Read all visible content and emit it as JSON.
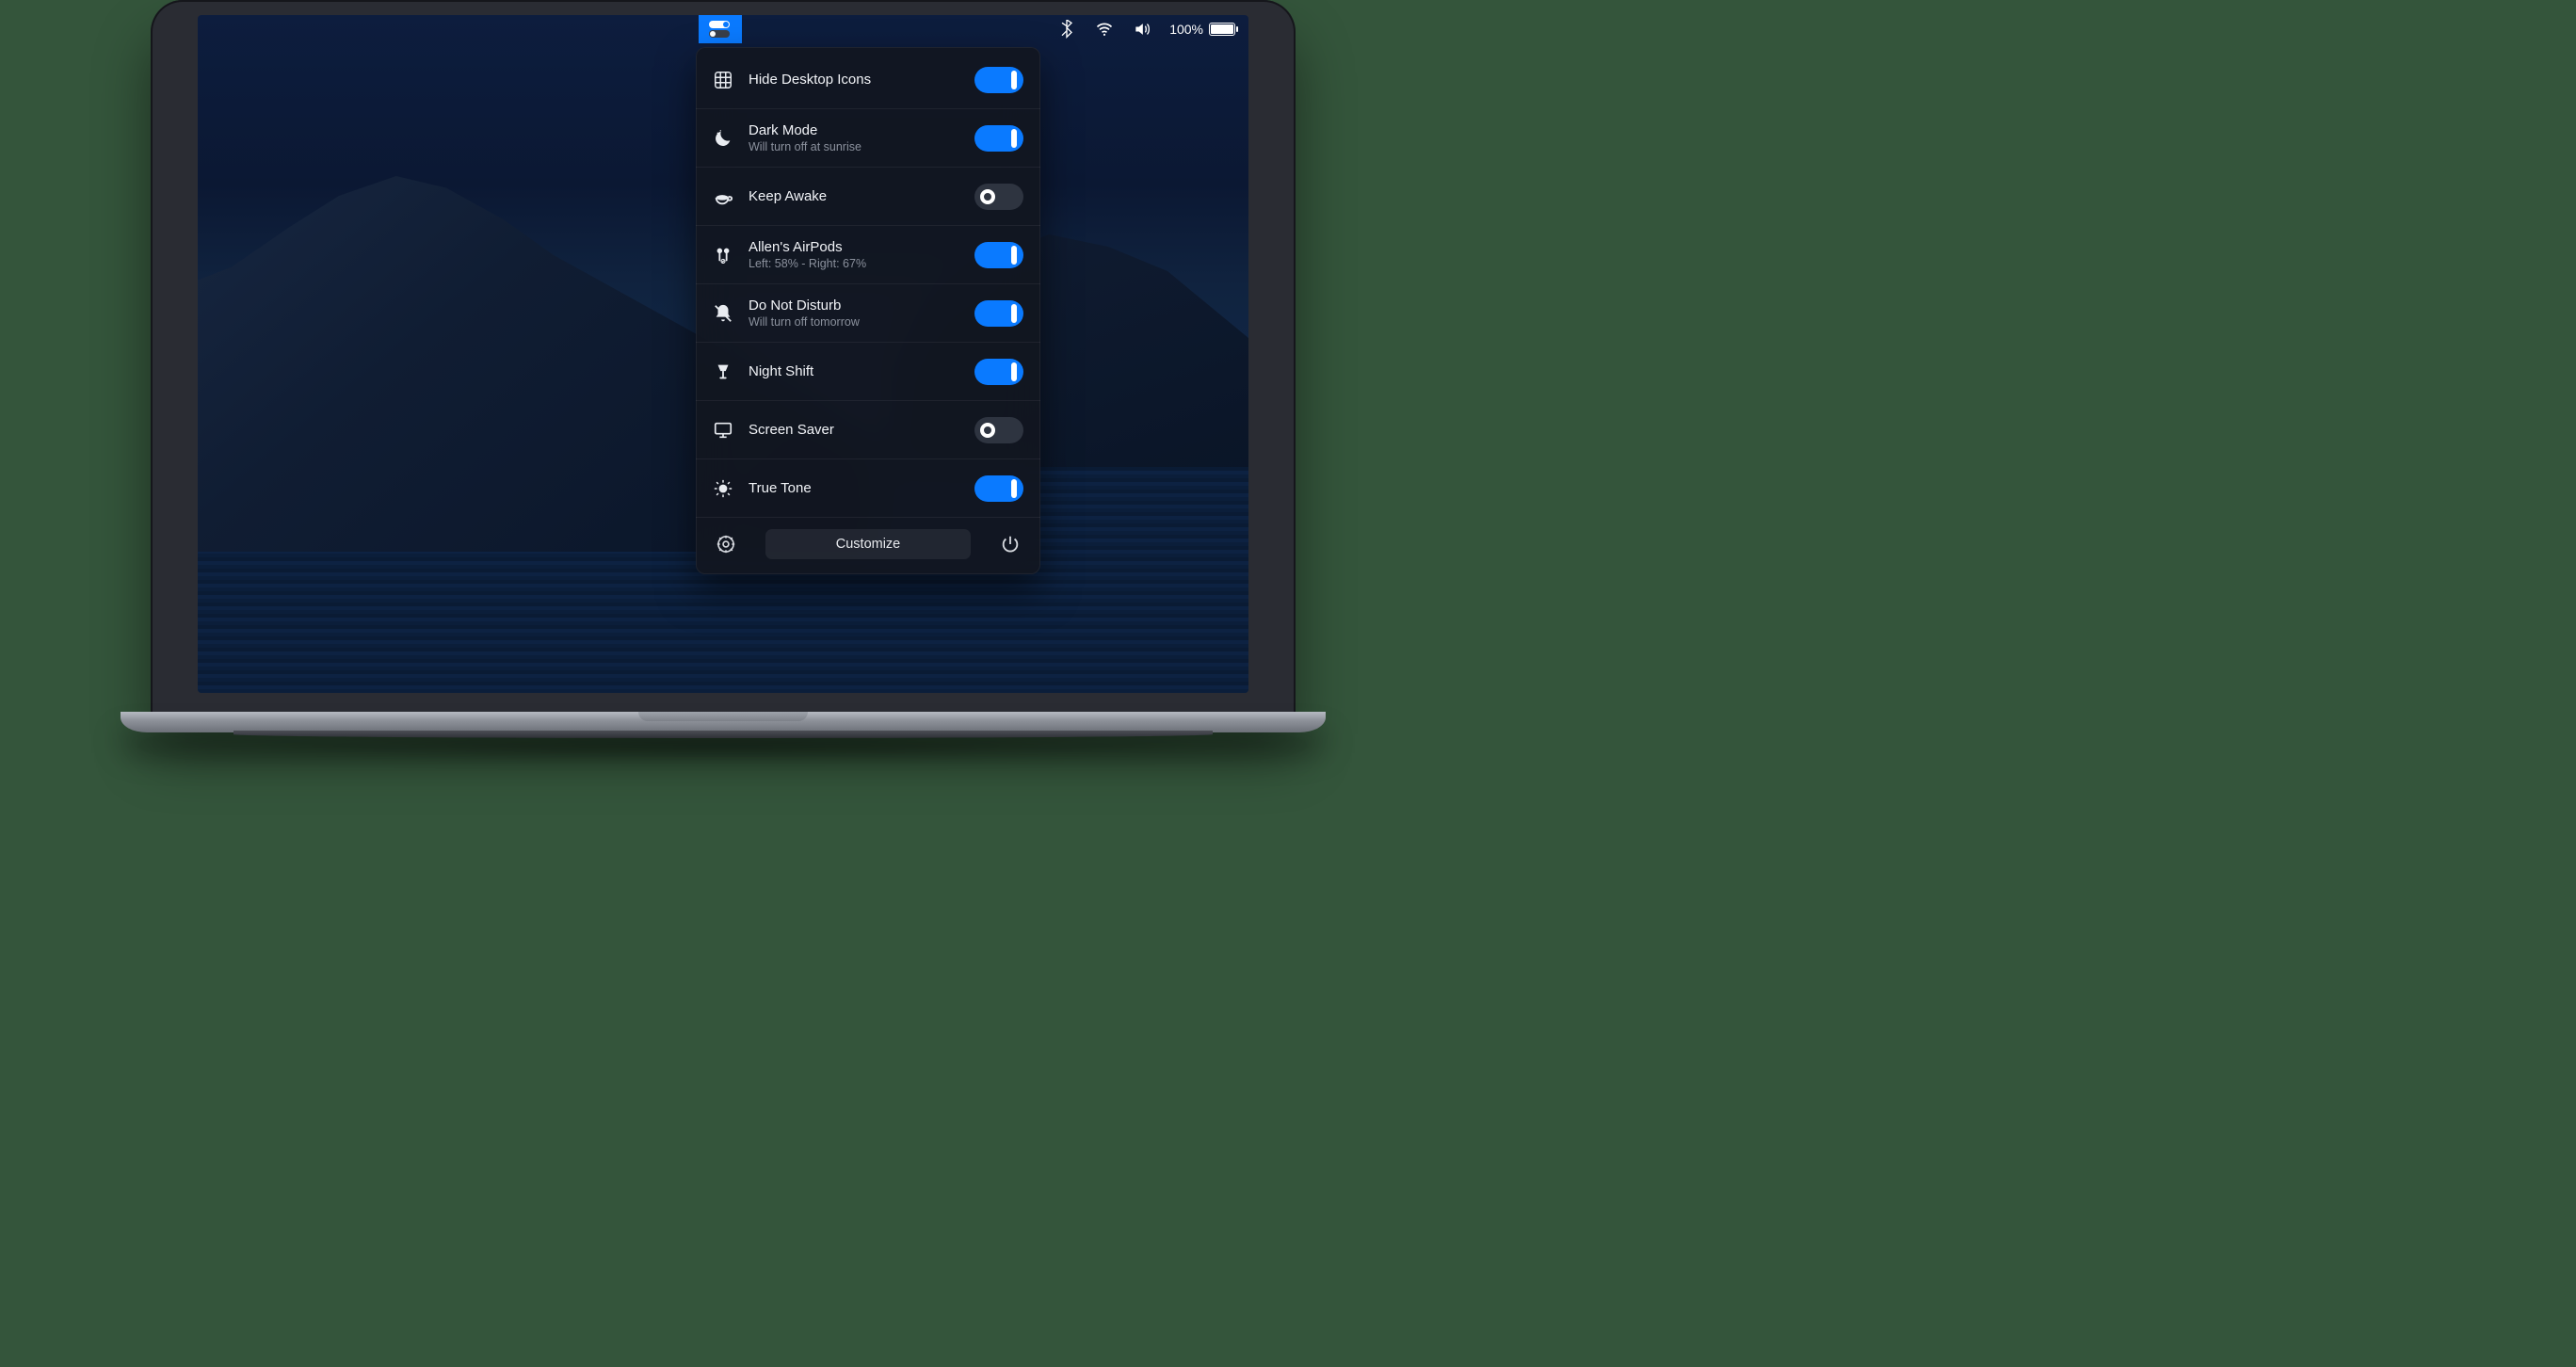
{
  "menubar": {
    "battery_text": "100%"
  },
  "panel": {
    "rows": [
      {
        "icon": "grid-icon",
        "title": "Hide Desktop Icons",
        "sub": "",
        "on": true
      },
      {
        "icon": "moon-icon",
        "title": "Dark Mode",
        "sub": "Will turn off at sunrise",
        "on": true
      },
      {
        "icon": "coffee-icon",
        "title": "Keep Awake",
        "sub": "",
        "on": false
      },
      {
        "icon": "airpods-icon",
        "title": "Allen's AirPods",
        "sub": "Left: 58% - Right: 67%",
        "on": true
      },
      {
        "icon": "dnd-icon",
        "title": "Do Not Disturb",
        "sub": "Will turn off tomorrow",
        "on": true
      },
      {
        "icon": "lamp-icon",
        "title": "Night Shift",
        "sub": "",
        "on": true
      },
      {
        "icon": "monitor-icon",
        "title": "Screen Saver",
        "sub": "",
        "on": false
      },
      {
        "icon": "truetone-icon",
        "title": "True Tone",
        "sub": "",
        "on": true
      }
    ],
    "footer": {
      "customize_label": "Customize"
    }
  }
}
